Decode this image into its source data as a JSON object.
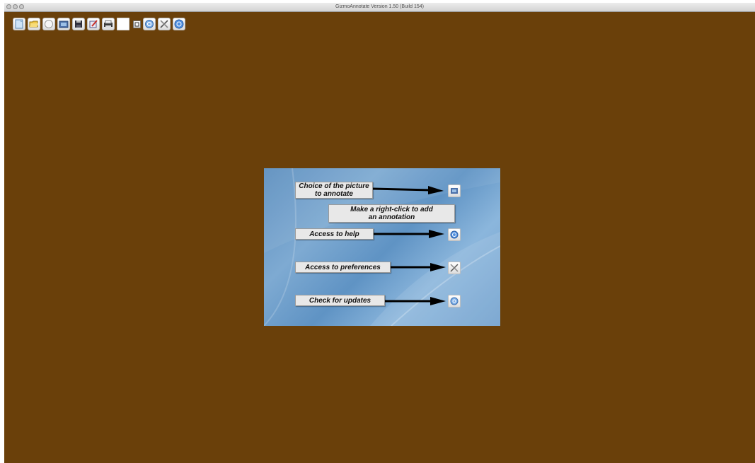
{
  "window": {
    "title": "GizmoAnnotate Version 1.50 (Build 154)"
  },
  "toolbar": {
    "buttons": [
      {
        "name": "new-document-icon"
      },
      {
        "name": "open-folder-icon"
      },
      {
        "name": "clock-icon"
      },
      {
        "name": "picture-choice-icon"
      },
      {
        "name": "save-disk-icon"
      },
      {
        "name": "export-icon"
      },
      {
        "name": "print-icon"
      },
      {
        "name": "blank-color-swatch"
      },
      {
        "name": "frame-icon"
      },
      {
        "name": "check-updates-icon"
      },
      {
        "name": "preferences-tools-icon"
      },
      {
        "name": "help-icon"
      }
    ]
  },
  "help_panel": {
    "picture_choice_label": "Choice of the picture\nto annotate",
    "right_click_hint": "Make a right-click to add an annotation",
    "help_label": "Access to help",
    "preferences_label": "Access to preferences",
    "updates_label": "Check for updates"
  },
  "colors": {
    "background": "#6a400a",
    "panel_blue": "#6f9fcd"
  }
}
